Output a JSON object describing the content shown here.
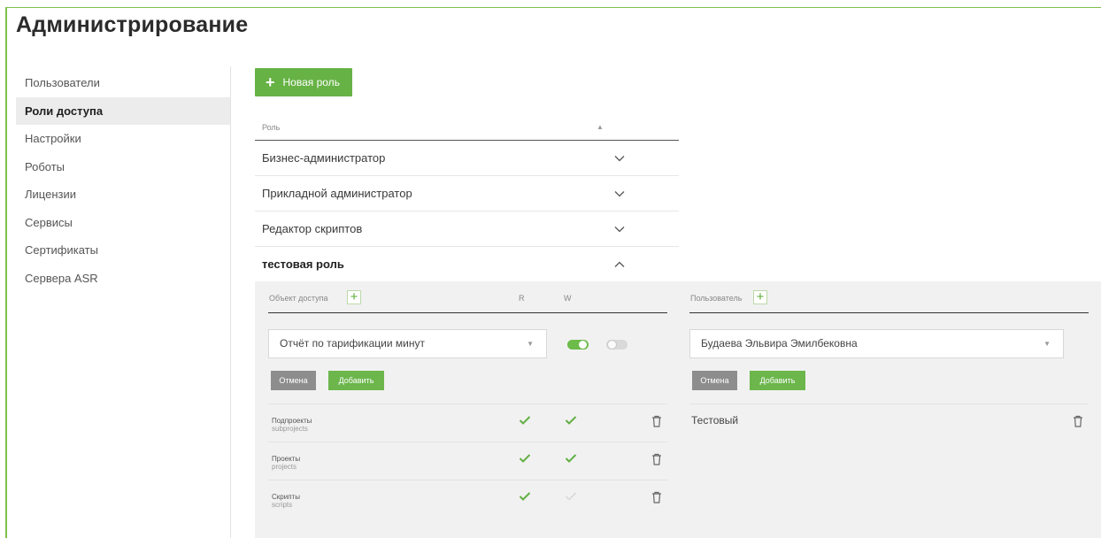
{
  "page": {
    "title": "Администрирование",
    "accent": "#66b245"
  },
  "sidebar": {
    "items": [
      {
        "label": "Пользователи",
        "active": false
      },
      {
        "label": "Роли доступа",
        "active": true
      },
      {
        "label": "Настройки",
        "active": false
      },
      {
        "label": "Роботы",
        "active": false
      },
      {
        "label": "Лицензии",
        "active": false
      },
      {
        "label": "Сервисы",
        "active": false
      },
      {
        "label": "Сертификаты",
        "active": false
      },
      {
        "label": "Сервера ASR",
        "active": false
      }
    ]
  },
  "toolbar": {
    "new_role_label": "Новая роль",
    "new_role_icon": "plus-icon"
  },
  "roles": {
    "column_header": "Роль",
    "sort_icon": "sort-icon",
    "rows": [
      {
        "name": "Бизнес-администратор",
        "expanded": false
      },
      {
        "name": "Прикладной администратор",
        "expanded": false
      },
      {
        "name": "Редактор скриптов",
        "expanded": false
      },
      {
        "name": "тестовая роль",
        "expanded": true
      }
    ]
  },
  "details": {
    "access": {
      "header": "Объект доступа",
      "col_r": "R",
      "col_w": "W",
      "select_value": "Отчёт по тарификации минут",
      "toggle_r": true,
      "toggle_w": false,
      "cancel_label": "Отмена",
      "add_label": "Добавить",
      "items": [
        {
          "name": "Подпроекты",
          "code": "subprojects",
          "r": true,
          "w": true
        },
        {
          "name": "Проекты",
          "code": "projects",
          "r": true,
          "w": true
        },
        {
          "name": "Скрипты",
          "code": "scripts",
          "r": true,
          "w": false
        }
      ]
    },
    "users": {
      "header": "Пользователь",
      "select_value": "Будаева Эльвира Эмилбековна",
      "cancel_label": "Отмена",
      "add_label": "Добавить",
      "items": [
        {
          "name": "Тестовый"
        }
      ]
    }
  }
}
